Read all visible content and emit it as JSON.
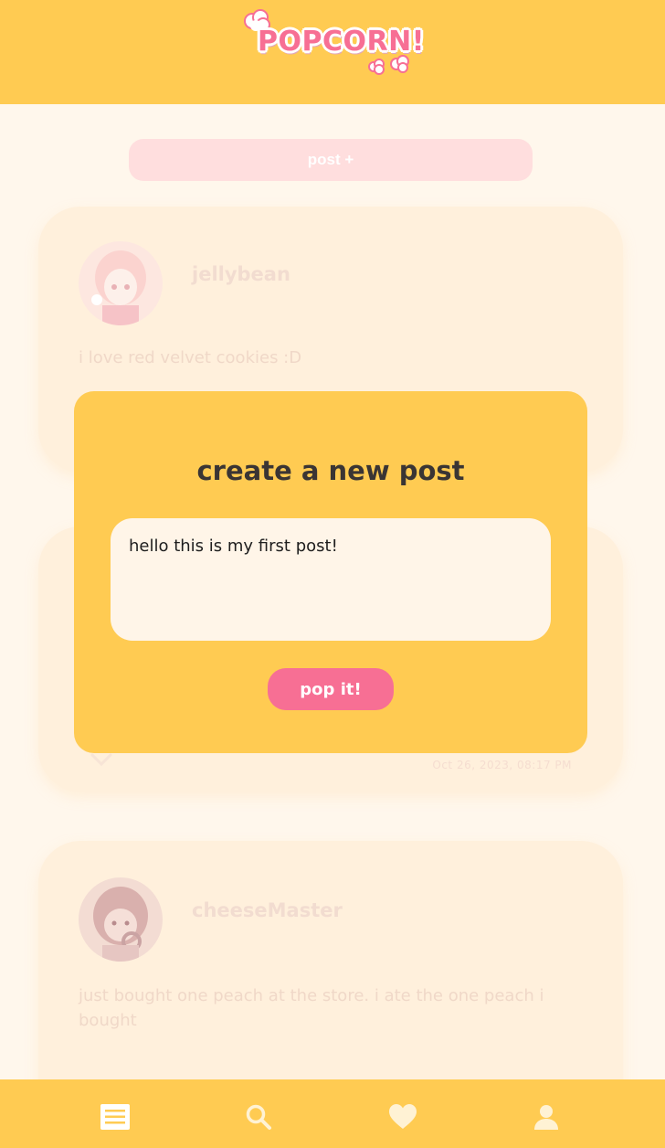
{
  "app": {
    "logo_text": "POPCORN!"
  },
  "feed": {
    "post_button_label": "post +",
    "posts": [
      {
        "username": "jellybean",
        "text": "i love red velvet cookies :D",
        "timestamp": ""
      },
      {
        "username": "",
        "text": "",
        "timestamp": "Oct 26, 2023, 08:17 PM"
      },
      {
        "username": "cheeseMaster",
        "text": "just bought one peach at the store. i ate the one peach i bought",
        "timestamp": ""
      }
    ]
  },
  "modal": {
    "title": "create a new post",
    "input_value": "hello this is my first post!",
    "submit_label": "pop it!"
  },
  "nav": {
    "items": [
      {
        "icon": "feed-icon"
      },
      {
        "icon": "search-icon"
      },
      {
        "icon": "heart-icon"
      },
      {
        "icon": "profile-icon"
      }
    ]
  },
  "colors": {
    "header": "#ffcb52",
    "background": "#fff7ec",
    "accent_pink": "#f76f94",
    "modal": "#ffcb52"
  }
}
